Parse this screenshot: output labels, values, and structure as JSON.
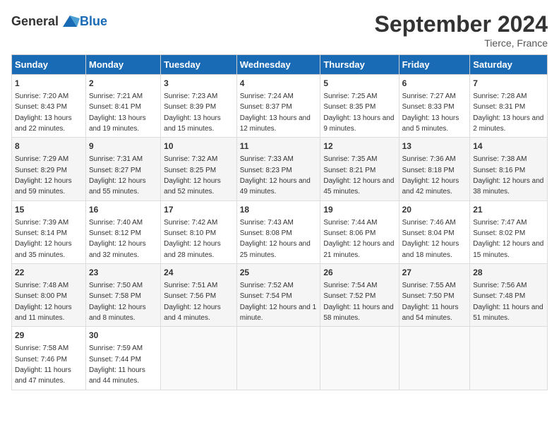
{
  "logo": {
    "general": "General",
    "blue": "Blue"
  },
  "title": "September 2024",
  "subtitle": "Tierce, France",
  "headers": [
    "Sunday",
    "Monday",
    "Tuesday",
    "Wednesday",
    "Thursday",
    "Friday",
    "Saturday"
  ],
  "weeks": [
    [
      {
        "day": "1",
        "sunrise": "7:20 AM",
        "sunset": "8:43 PM",
        "daylight": "13 hours and 22 minutes."
      },
      {
        "day": "2",
        "sunrise": "7:21 AM",
        "sunset": "8:41 PM",
        "daylight": "13 hours and 19 minutes."
      },
      {
        "day": "3",
        "sunrise": "7:23 AM",
        "sunset": "8:39 PM",
        "daylight": "13 hours and 15 minutes."
      },
      {
        "day": "4",
        "sunrise": "7:24 AM",
        "sunset": "8:37 PM",
        "daylight": "13 hours and 12 minutes."
      },
      {
        "day": "5",
        "sunrise": "7:25 AM",
        "sunset": "8:35 PM",
        "daylight": "13 hours and 9 minutes."
      },
      {
        "day": "6",
        "sunrise": "7:27 AM",
        "sunset": "8:33 PM",
        "daylight": "13 hours and 5 minutes."
      },
      {
        "day": "7",
        "sunrise": "7:28 AM",
        "sunset": "8:31 PM",
        "daylight": "13 hours and 2 minutes."
      }
    ],
    [
      {
        "day": "8",
        "sunrise": "7:29 AM",
        "sunset": "8:29 PM",
        "daylight": "12 hours and 59 minutes."
      },
      {
        "day": "9",
        "sunrise": "7:31 AM",
        "sunset": "8:27 PM",
        "daylight": "12 hours and 55 minutes."
      },
      {
        "day": "10",
        "sunrise": "7:32 AM",
        "sunset": "8:25 PM",
        "daylight": "12 hours and 52 minutes."
      },
      {
        "day": "11",
        "sunrise": "7:33 AM",
        "sunset": "8:23 PM",
        "daylight": "12 hours and 49 minutes."
      },
      {
        "day": "12",
        "sunrise": "7:35 AM",
        "sunset": "8:21 PM",
        "daylight": "12 hours and 45 minutes."
      },
      {
        "day": "13",
        "sunrise": "7:36 AM",
        "sunset": "8:18 PM",
        "daylight": "12 hours and 42 minutes."
      },
      {
        "day": "14",
        "sunrise": "7:38 AM",
        "sunset": "8:16 PM",
        "daylight": "12 hours and 38 minutes."
      }
    ],
    [
      {
        "day": "15",
        "sunrise": "7:39 AM",
        "sunset": "8:14 PM",
        "daylight": "12 hours and 35 minutes."
      },
      {
        "day": "16",
        "sunrise": "7:40 AM",
        "sunset": "8:12 PM",
        "daylight": "12 hours and 32 minutes."
      },
      {
        "day": "17",
        "sunrise": "7:42 AM",
        "sunset": "8:10 PM",
        "daylight": "12 hours and 28 minutes."
      },
      {
        "day": "18",
        "sunrise": "7:43 AM",
        "sunset": "8:08 PM",
        "daylight": "12 hours and 25 minutes."
      },
      {
        "day": "19",
        "sunrise": "7:44 AM",
        "sunset": "8:06 PM",
        "daylight": "12 hours and 21 minutes."
      },
      {
        "day": "20",
        "sunrise": "7:46 AM",
        "sunset": "8:04 PM",
        "daylight": "12 hours and 18 minutes."
      },
      {
        "day": "21",
        "sunrise": "7:47 AM",
        "sunset": "8:02 PM",
        "daylight": "12 hours and 15 minutes."
      }
    ],
    [
      {
        "day": "22",
        "sunrise": "7:48 AM",
        "sunset": "8:00 PM",
        "daylight": "12 hours and 11 minutes."
      },
      {
        "day": "23",
        "sunrise": "7:50 AM",
        "sunset": "7:58 PM",
        "daylight": "12 hours and 8 minutes."
      },
      {
        "day": "24",
        "sunrise": "7:51 AM",
        "sunset": "7:56 PM",
        "daylight": "12 hours and 4 minutes."
      },
      {
        "day": "25",
        "sunrise": "7:52 AM",
        "sunset": "7:54 PM",
        "daylight": "12 hours and 1 minute."
      },
      {
        "day": "26",
        "sunrise": "7:54 AM",
        "sunset": "7:52 PM",
        "daylight": "11 hours and 58 minutes."
      },
      {
        "day": "27",
        "sunrise": "7:55 AM",
        "sunset": "7:50 PM",
        "daylight": "11 hours and 54 minutes."
      },
      {
        "day": "28",
        "sunrise": "7:56 AM",
        "sunset": "7:48 PM",
        "daylight": "11 hours and 51 minutes."
      }
    ],
    [
      {
        "day": "29",
        "sunrise": "7:58 AM",
        "sunset": "7:46 PM",
        "daylight": "11 hours and 47 minutes."
      },
      {
        "day": "30",
        "sunrise": "7:59 AM",
        "sunset": "7:44 PM",
        "daylight": "11 hours and 44 minutes."
      },
      null,
      null,
      null,
      null,
      null
    ]
  ]
}
